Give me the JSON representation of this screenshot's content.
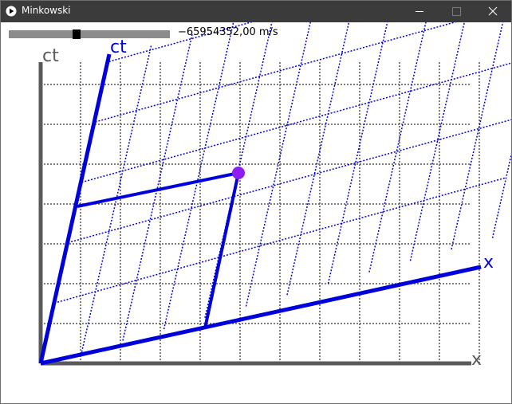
{
  "window": {
    "title": "Minkowski",
    "app_icon": "play-circle-icon",
    "controls": [
      "minimize-icon",
      "maximize-icon",
      "close-icon"
    ]
  },
  "controls": {
    "velocity_slider_fraction": 0.42,
    "velocity_text": "−65954352,00 m/s"
  },
  "diagram": {
    "rest_axes": {
      "time_label": "ct",
      "space_label": "x"
    },
    "moving_axes": {
      "time_label": "ct",
      "space_label": "x"
    },
    "colors": {
      "rest_axis": "#5a5a5a",
      "rest_grid": "#555555",
      "moving_frame": "#0000dd",
      "event": "#8f1cf0"
    }
  }
}
